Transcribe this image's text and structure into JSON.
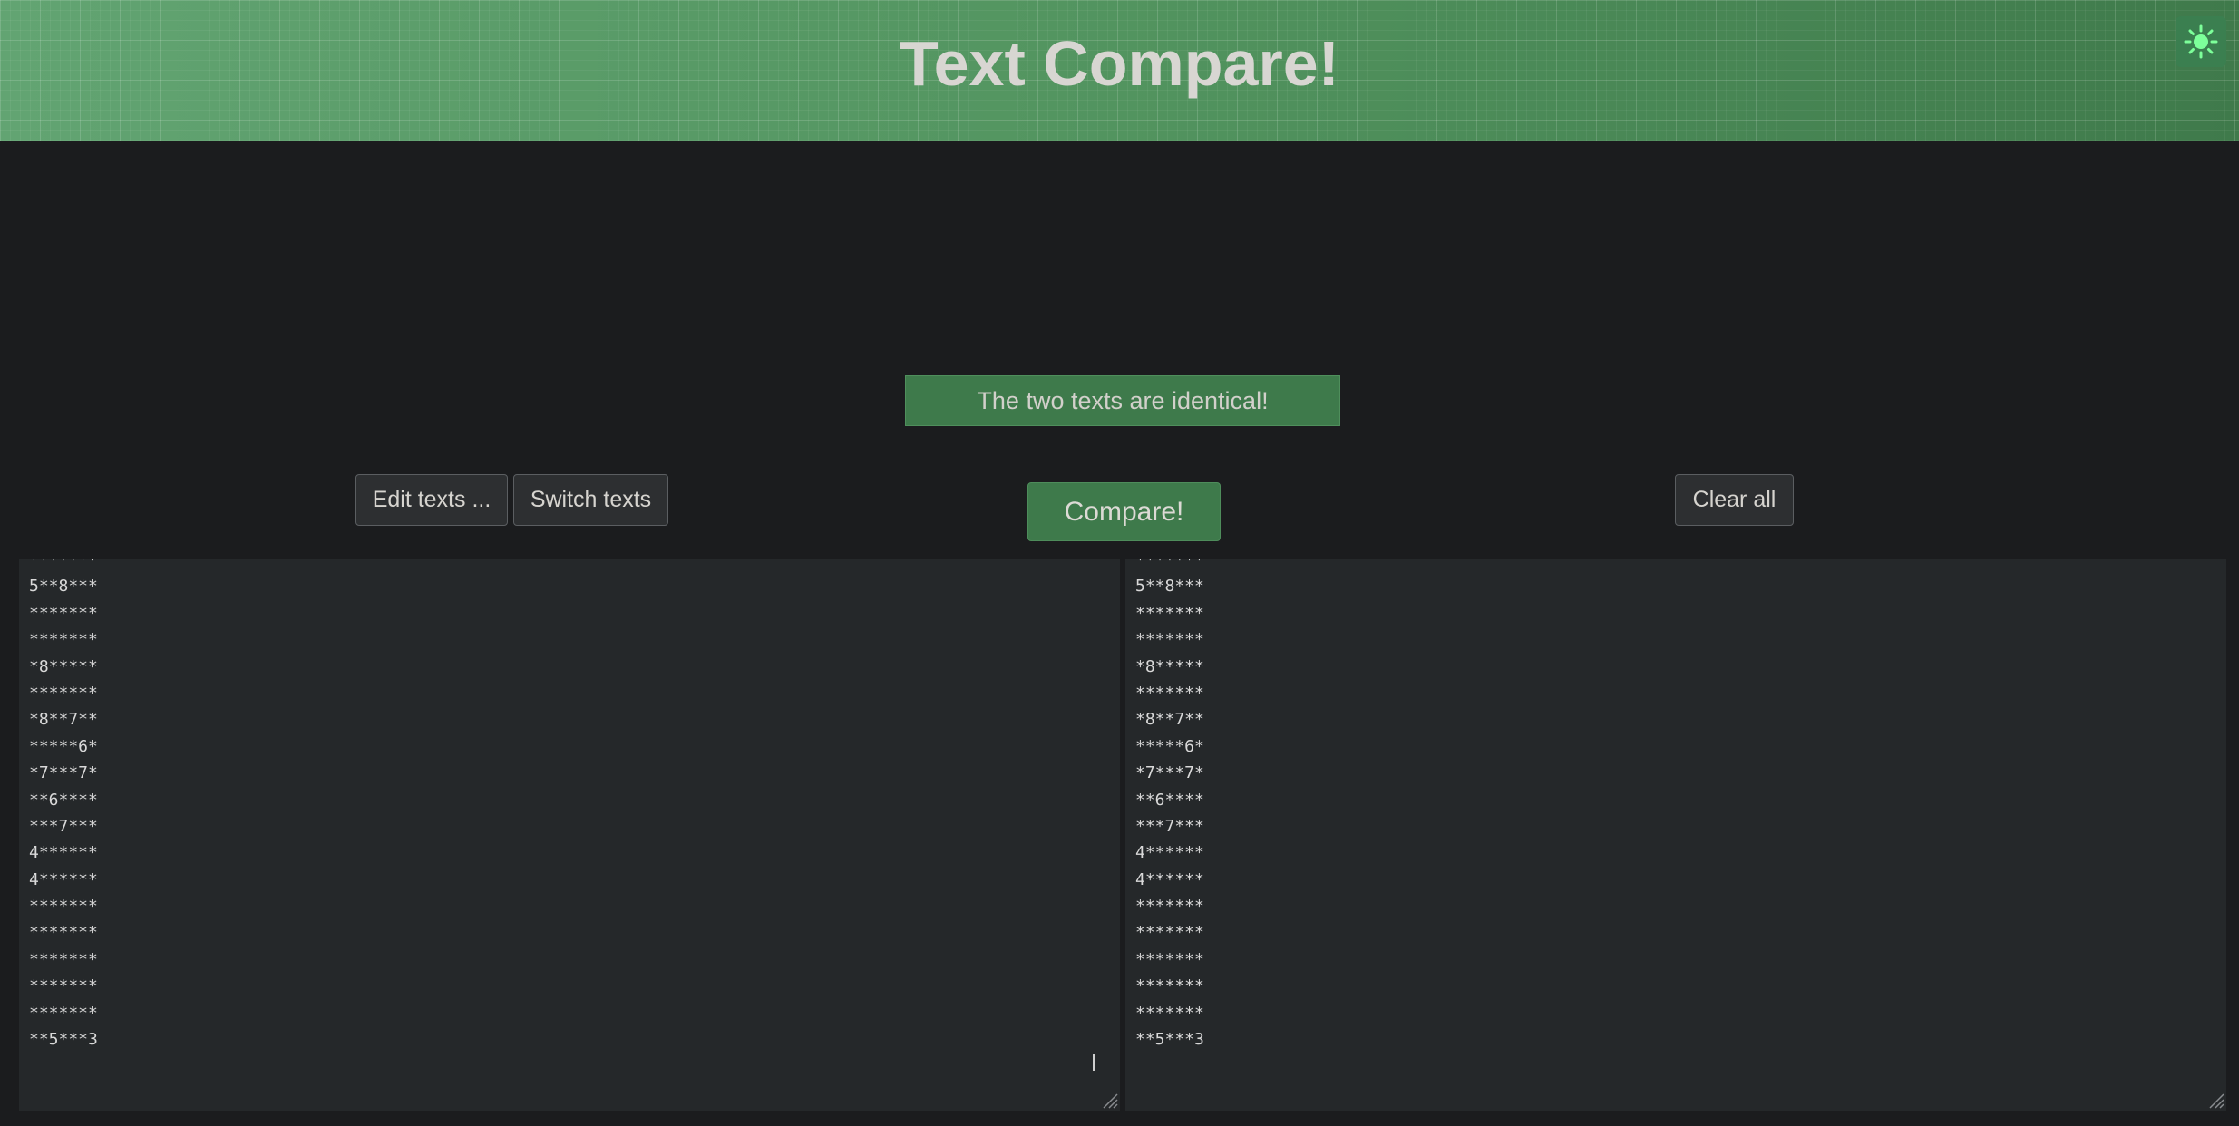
{
  "header": {
    "title": "Text Compare!",
    "theme_toggle_icon": "sun-icon",
    "accent_color": "#4a8a5a"
  },
  "status": {
    "message": "The two texts are identical!",
    "color": "#3e7a4b"
  },
  "toolbar": {
    "edit_label": "Edit texts ...",
    "switch_label": "Switch texts",
    "compare_label": "Compare!",
    "clear_label": "Clear all"
  },
  "left_text": {
    "lines": [
      "*******",
      "5**8***",
      "*******",
      "*******",
      "*8*****",
      "*******",
      "*8**7**",
      "*****6*",
      "*7***7*",
      "**6****",
      "***7***",
      "4******",
      "4******",
      "*******",
      "*******",
      "*******",
      "*******",
      "*******",
      "**5***3"
    ]
  },
  "right_text": {
    "lines": [
      "*******",
      "5**8***",
      "*******",
      "*******",
      "*8*****",
      "*******",
      "*8**7**",
      "*****6*",
      "*7***7*",
      "**6****",
      "***7***",
      "4******",
      "4******",
      "*******",
      "*******",
      "*******",
      "*******",
      "*******",
      "**5***3"
    ]
  }
}
